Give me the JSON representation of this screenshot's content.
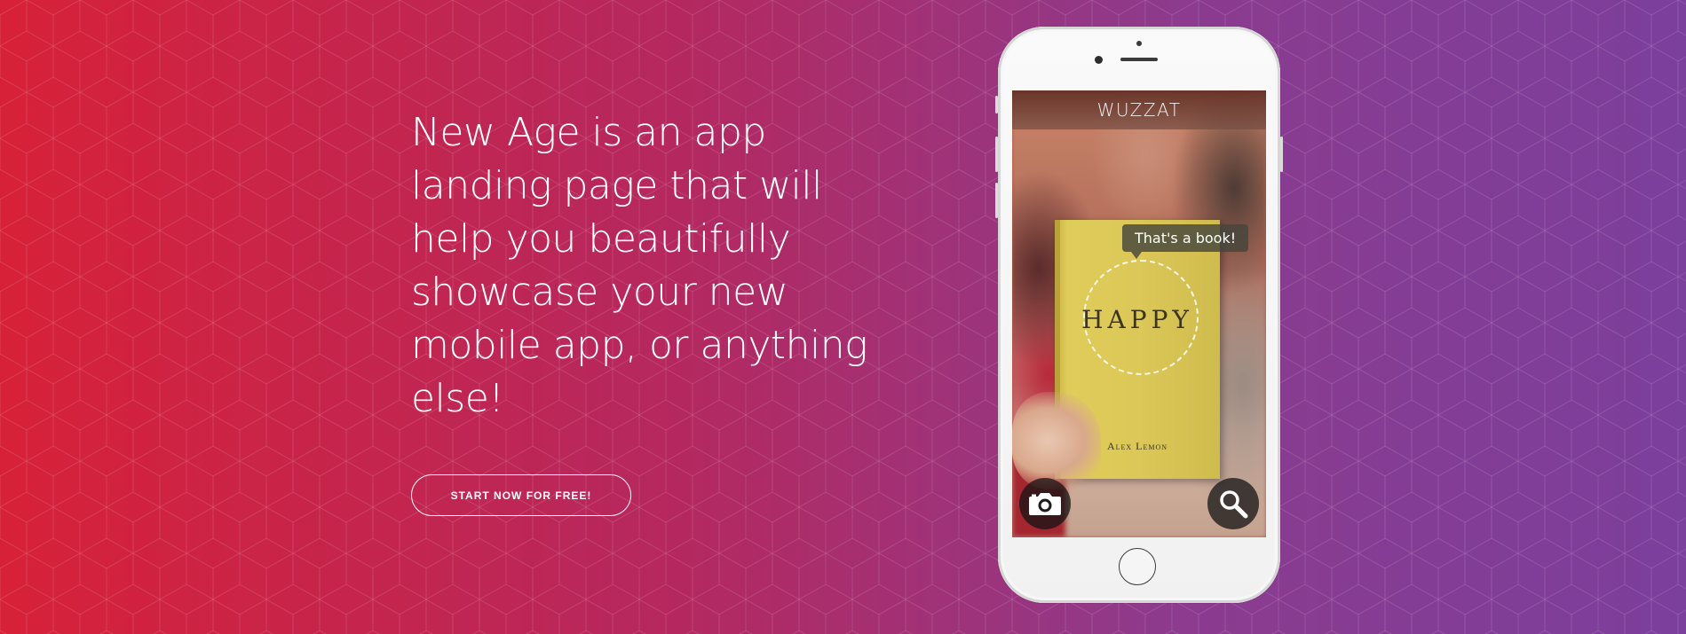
{
  "hero": {
    "headline": "New Age is an app landing page that will help you beautifully showcase your new mobile app, or anything else!",
    "cta_label": "START NOW FOR FREE!"
  },
  "phone_screen": {
    "app_title": "WUZZAT",
    "tooltip_text": "That's a book!",
    "book_title": "HAPPY",
    "book_author": "Alex Lemon",
    "camera_icon": "camera-icon",
    "search_icon": "search-icon"
  },
  "colors": {
    "gradient_start": "#d72138",
    "gradient_end": "#7b3f9c"
  }
}
